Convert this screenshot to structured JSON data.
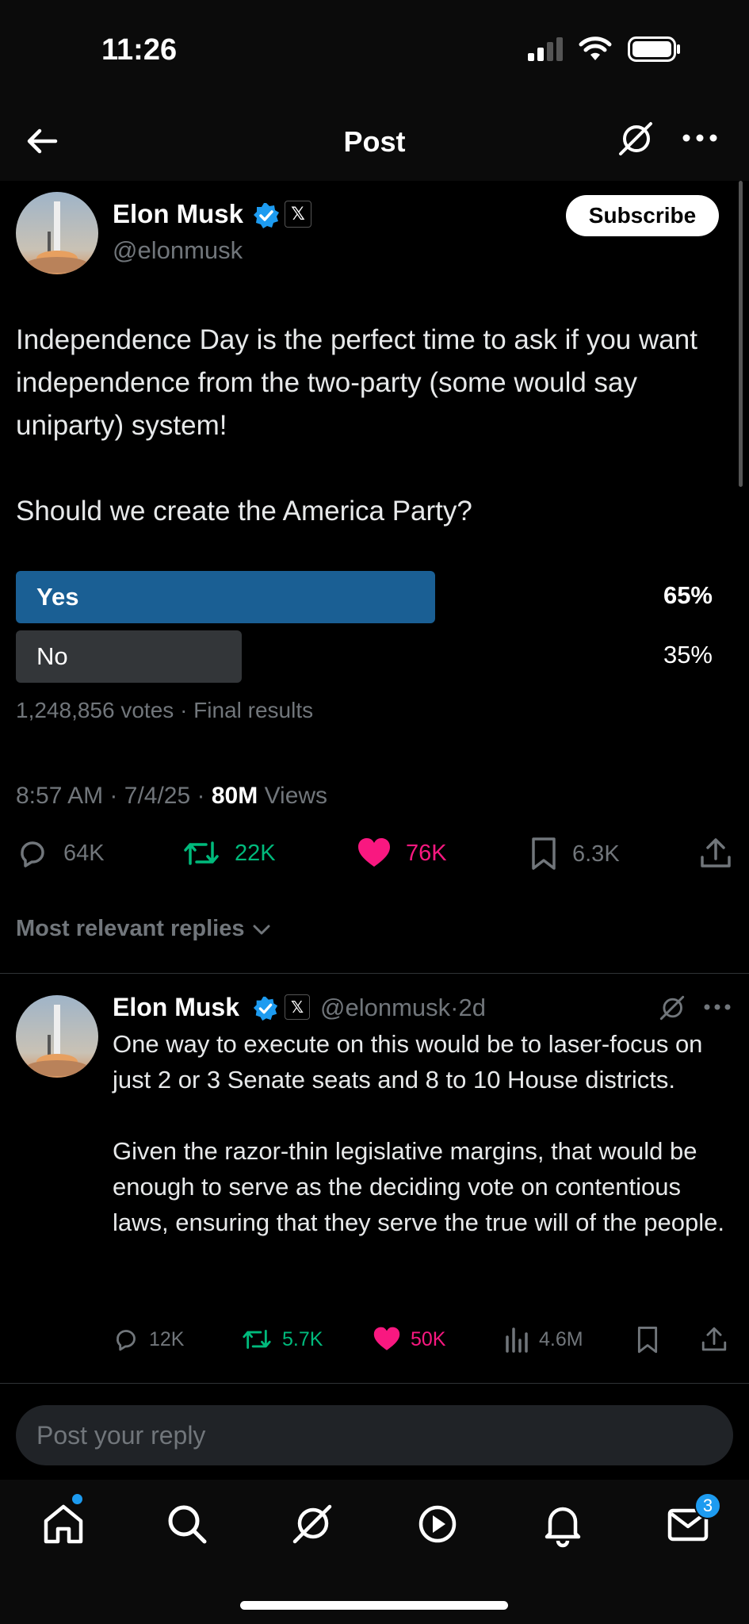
{
  "status_bar": {
    "time": "11:26"
  },
  "header": {
    "title": "Post"
  },
  "post": {
    "author": {
      "name": "Elon Musk",
      "handle": "@elonmusk",
      "x_badge": "𝕏"
    },
    "subscribe_label": "Subscribe",
    "text": "Independence Day is the perfect time to ask if you want independence from the two-party (some would say uniparty) system!\n\nShould we create the America Party?",
    "poll": {
      "options": [
        {
          "label": "Yes",
          "percent": "65%",
          "fraction": 0.65,
          "leading": true
        },
        {
          "label": "No",
          "percent": "35%",
          "fraction": 0.35,
          "leading": false
        }
      ],
      "votes": "1,248,856 votes",
      "status": "Final results",
      "separator": "·"
    },
    "time": "8:57 AM",
    "date": "7/4/25",
    "views_count": "80M",
    "views_label": "Views",
    "actions": {
      "replies": "64K",
      "reposts": "22K",
      "likes": "76K",
      "bookmarks": "6.3K"
    }
  },
  "replies_filter": {
    "label": "Most relevant replies"
  },
  "reply": {
    "author": {
      "name": "Elon Musk",
      "handle": "@elonmusk",
      "x_badge": "𝕏"
    },
    "age": "2d",
    "separator": "·",
    "text": "One way to execute on this would be to laser-focus on just 2 or 3 Senate seats and 8 to 10 House districts.\n\nGiven the razor-thin legislative margins, that would be enough to serve as the deciding vote on contentious laws, ensuring that they serve the true will of the people.",
    "actions": {
      "replies": "12K",
      "reposts": "5.7K",
      "likes": "50K",
      "views": "4.6M"
    }
  },
  "composer": {
    "placeholder": "Post your reply"
  },
  "tabbar": {
    "messages_badge": "3"
  },
  "colors": {
    "accent": "#1d9bf0",
    "repost": "#00ba7c",
    "like": "#f91880",
    "poll_leading": "#1a5f94",
    "poll_other": "#333639"
  }
}
